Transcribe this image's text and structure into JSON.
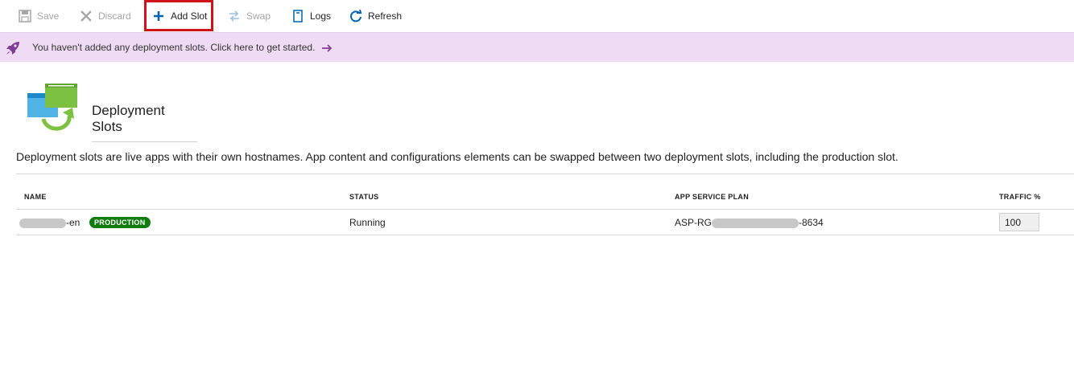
{
  "toolbar": {
    "save_label": "Save",
    "discard_label": "Discard",
    "add_slot_label": "Add Slot",
    "swap_label": "Swap",
    "logs_label": "Logs",
    "refresh_label": "Refresh",
    "highlight_color": "#d0131b",
    "accent_color": "#0063b1"
  },
  "banner": {
    "text": "You haven't added any deployment slots. Click here to get started.",
    "background": "#efdbf3",
    "icon": "rocket-icon",
    "arrow_icon": "arrow-right-icon"
  },
  "header": {
    "title": "Deployment Slots",
    "icon": "deployment-slots-icon"
  },
  "description": "Deployment slots are live apps with their own hostnames. App content and configurations elements can be swapped between two deployment slots, including the production slot.",
  "table": {
    "columns": [
      "NAME",
      "STATUS",
      "APP SERVICE PLAN",
      "TRAFFIC %"
    ],
    "rows": [
      {
        "name_suffix": "-en",
        "badge": "PRODUCTION",
        "badge_color": "#107c10",
        "status": "Running",
        "plan_prefix": "ASP-RG",
        "plan_suffix": "-8634",
        "traffic": "100"
      }
    ]
  }
}
